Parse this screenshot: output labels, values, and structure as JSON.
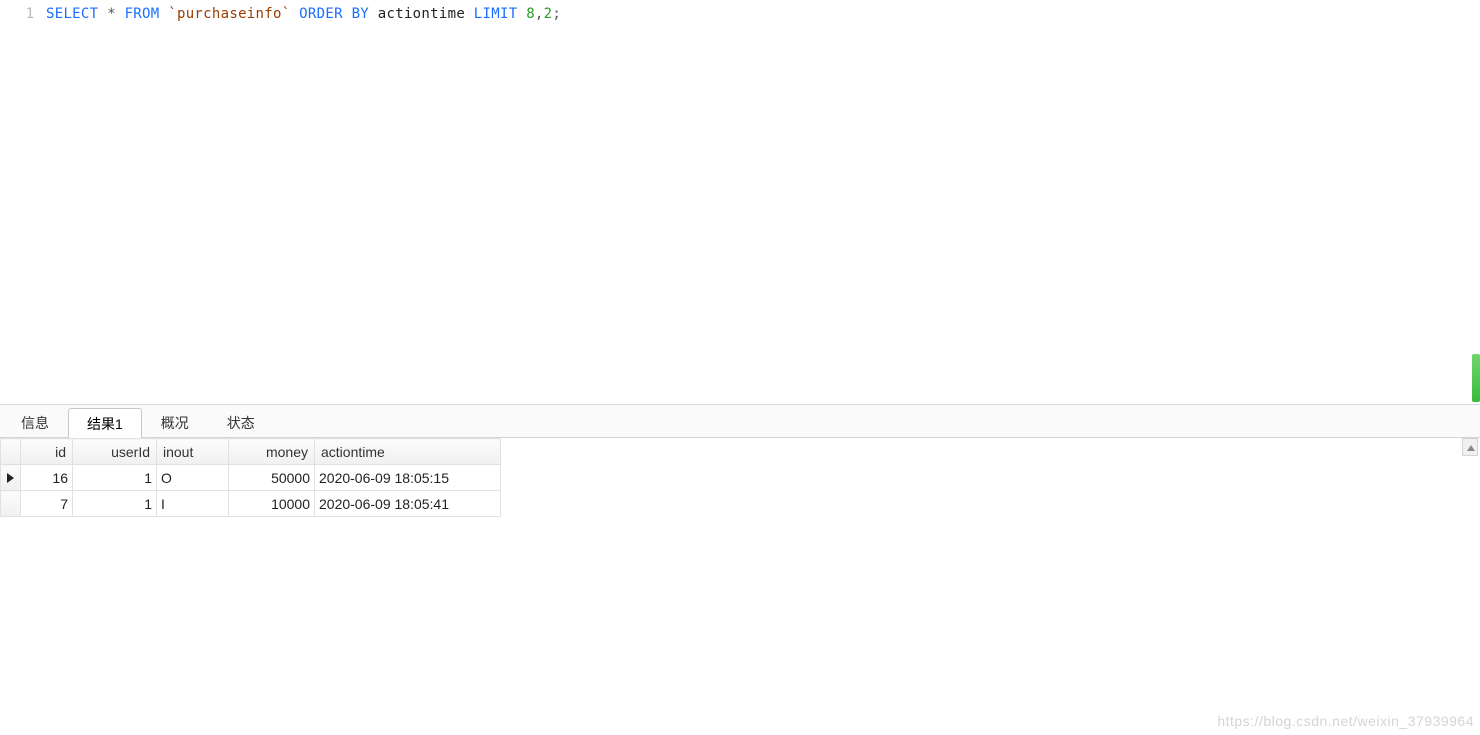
{
  "editor": {
    "line_number": "1",
    "sql": {
      "kw_select": "SELECT",
      "star": "*",
      "kw_from": "FROM",
      "table_name": "`purchaseinfo`",
      "kw_order": "ORDER",
      "kw_by": "BY",
      "col_order": "actiontime",
      "kw_limit": "LIMIT",
      "limit_offset": "8",
      "comma": ",",
      "limit_count": "2",
      "semicolon": ";"
    }
  },
  "tabs": {
    "items": [
      {
        "label": "信息",
        "active": false
      },
      {
        "label": "结果1",
        "active": true
      },
      {
        "label": "概况",
        "active": false
      },
      {
        "label": "状态",
        "active": false
      }
    ]
  },
  "grid": {
    "columns": [
      {
        "key": "id",
        "label": "id"
      },
      {
        "key": "userId",
        "label": "userId"
      },
      {
        "key": "inout",
        "label": "inout"
      },
      {
        "key": "money",
        "label": "money"
      },
      {
        "key": "actiontime",
        "label": "actiontime"
      }
    ],
    "rows": [
      {
        "current": true,
        "id": "16",
        "userId": "1",
        "inout": "O",
        "money": "50000",
        "actiontime": "2020-06-09 18:05:15"
      },
      {
        "current": false,
        "id": "7",
        "userId": "1",
        "inout": "I",
        "money": "10000",
        "actiontime": "2020-06-09 18:05:41"
      }
    ]
  },
  "watermark": "https://blog.csdn.net/weixin_37939964"
}
